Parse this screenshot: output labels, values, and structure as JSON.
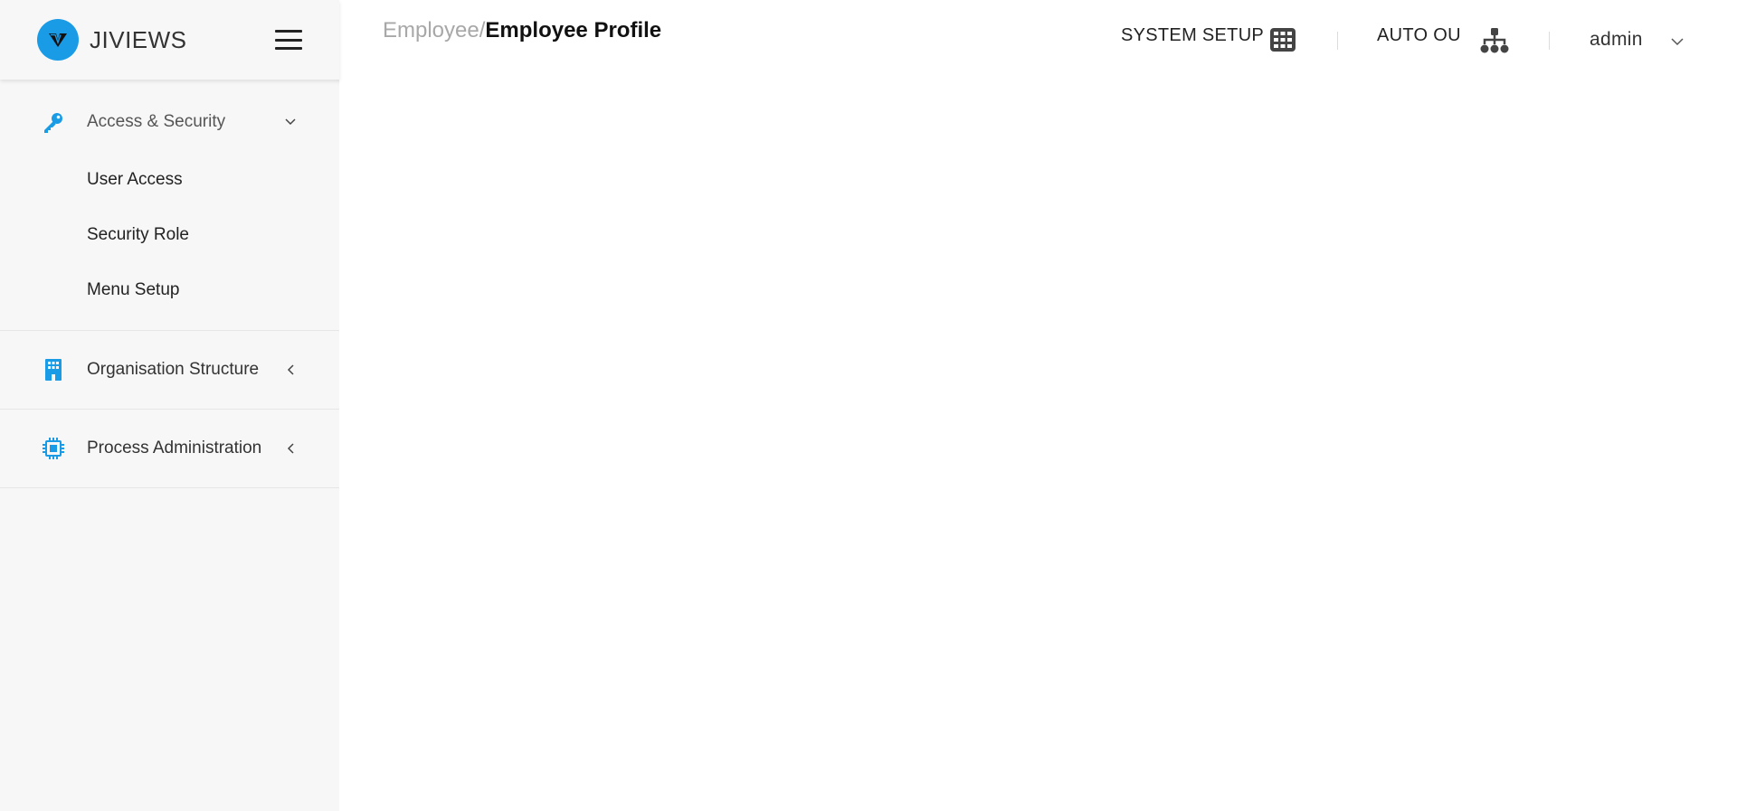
{
  "brand": {
    "name": "JIVIEWS",
    "logo_color": "#1a9be6"
  },
  "breadcrumb": {
    "parent": "Employee/",
    "current": "Employee Profile"
  },
  "topbar": {
    "system_setup": "SYSTEM SETUP",
    "auto_ou": "AUTO OU",
    "user": "admin"
  },
  "sidebar": {
    "sections": [
      {
        "label": "Access & Security",
        "icon": "key-icon",
        "expanded": true,
        "items": [
          "User Access",
          "Security Role",
          "Menu Setup"
        ]
      },
      {
        "label": "Organisation Structure",
        "icon": "building-icon",
        "expanded": false
      },
      {
        "label": "Process Administration",
        "icon": "chip-icon",
        "expanded": false
      }
    ]
  },
  "colors": {
    "accent": "#1a9be6",
    "sidebar_bg": "#f7f7f7"
  }
}
